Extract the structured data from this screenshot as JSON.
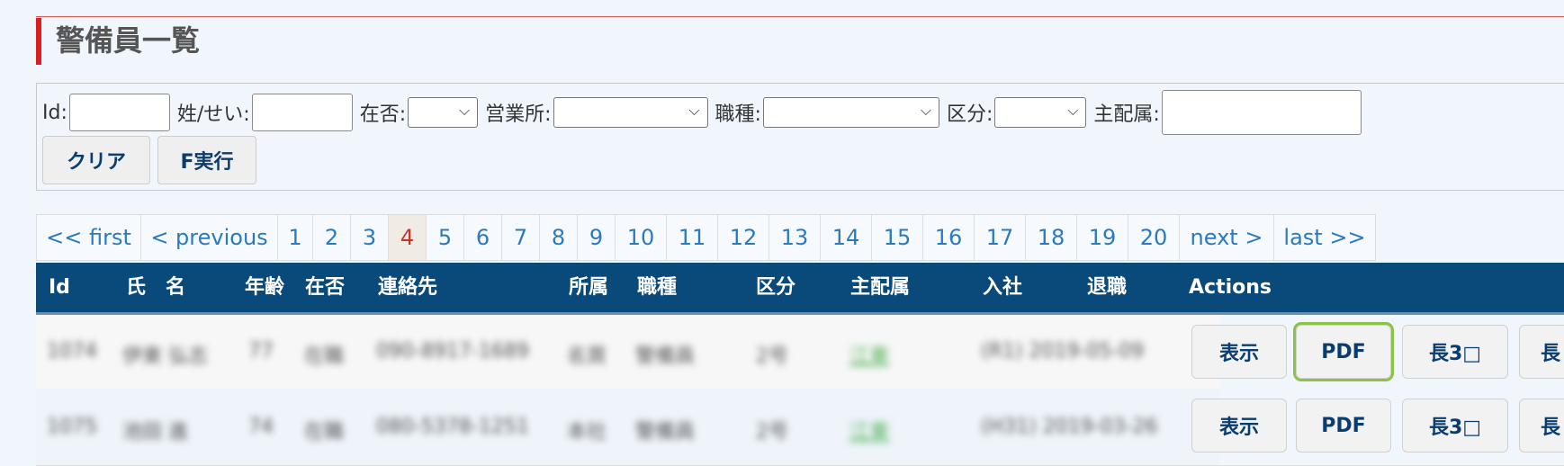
{
  "page": {
    "title": "警備員一覧"
  },
  "filter": {
    "id_label": "Id:",
    "name_label": "姓/せい:",
    "status_label": "在否:",
    "office_label": "営業所:",
    "job_label": "職種:",
    "category_label": "区分:",
    "main_label": "主配属:",
    "clear_button": "クリア",
    "run_button": "F実行"
  },
  "pagination": {
    "first": "<< first",
    "previous": "< previous",
    "pages": [
      "1",
      "2",
      "3",
      "4",
      "5",
      "6",
      "7",
      "8",
      "9",
      "10",
      "11",
      "12",
      "13",
      "14",
      "15",
      "16",
      "17",
      "18",
      "19",
      "20"
    ],
    "current": "4",
    "next": "next >",
    "last": "last >>"
  },
  "table": {
    "headers": [
      "Id",
      "氏　名",
      "年齢",
      "在否",
      "連絡先",
      "所属",
      "職種",
      "区分",
      "主配属",
      "入社",
      "退職",
      "Actions"
    ],
    "rows": [
      {
        "id": "1074",
        "name": "伊東 弘志",
        "age": "77",
        "status": "在職",
        "contact": "090-8917-1689",
        "office": "名買",
        "job": "警備員",
        "category": "2号",
        "main": "江東",
        "joined": "(R1) 2019-05-09",
        "left": ""
      },
      {
        "id": "1075",
        "name": "池田 進",
        "age": "74",
        "status": "在職",
        "contact": "080-5378-1251",
        "office": "本社",
        "job": "警備員",
        "category": "2号",
        "main": "江東",
        "joined": "(H31) 2019-03-26",
        "left": ""
      }
    ],
    "action_labels": {
      "view": "表示",
      "pdf": "PDF",
      "envelope": "長3□",
      "more": "長"
    }
  }
}
